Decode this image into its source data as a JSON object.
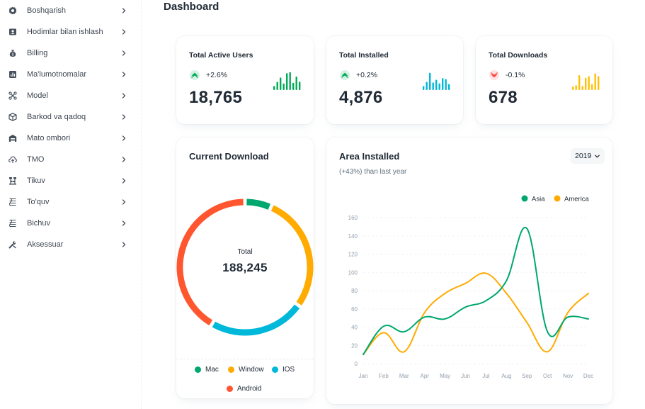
{
  "page": {
    "title": "Dashboard"
  },
  "sidebar": {
    "items": [
      {
        "label": "Boshqarish",
        "icon": "gear-icon"
      },
      {
        "label": "Hodimlar bilan ishlash",
        "icon": "id-card-icon"
      },
      {
        "label": "Billing",
        "icon": "money-bag-icon"
      },
      {
        "label": "Ma'lumotnomalar",
        "icon": "report-chart-icon"
      },
      {
        "label": "Model",
        "icon": "network-icon"
      },
      {
        "label": "Barkod va qadoq",
        "icon": "package-icon"
      },
      {
        "label": "Mato ombori",
        "icon": "warehouse-icon"
      },
      {
        "label": "TMO",
        "icon": "cloud-upload-icon"
      },
      {
        "label": "Tikuv",
        "icon": "sewing-icon"
      },
      {
        "label": "To'quv",
        "icon": "weaving-icon"
      },
      {
        "label": "Bichuv",
        "icon": "cutting-icon"
      },
      {
        "label": "Aksessuar",
        "icon": "tools-icon"
      }
    ]
  },
  "stats": [
    {
      "title": "Total Active Users",
      "trend": "+2.6%",
      "direction": "up",
      "value": "18,765",
      "color": "#00ab55",
      "bars": [
        20,
        41,
        63,
        33,
        85,
        90,
        36,
        68,
        42
      ]
    },
    {
      "title": "Total Installed",
      "trend": "+0.2%",
      "direction": "up",
      "value": "4,876",
      "color": "#00b8d9",
      "bars": [
        20,
        41,
        87,
        38,
        52,
        34,
        60,
        55,
        30
      ]
    },
    {
      "title": "Total Downloads",
      "trend": "-0.1%",
      "direction": "down",
      "value": "678",
      "color": "#ffc107",
      "bars": [
        18,
        24,
        75,
        20,
        62,
        70,
        30,
        84,
        70
      ]
    }
  ],
  "colors": {
    "up_icon": "#00ab55",
    "down_icon": "#ff4842"
  },
  "current_download": {
    "title": "Current Download",
    "total_label": "Total",
    "total_value": "188,245",
    "legend": [
      {
        "label": "Mac",
        "color": "#00a76f"
      },
      {
        "label": "Window",
        "color": "#ffab00"
      },
      {
        "label": "IOS",
        "color": "#00b8d9"
      },
      {
        "label": "Android",
        "color": "#ff5630"
      }
    ]
  },
  "area_installed": {
    "title": "Area Installed",
    "subtitle": "(+43%) than last year",
    "year": "2019"
  },
  "chart_data": [
    {
      "type": "pie",
      "variant": "donut",
      "title": "Current Download",
      "categories": [
        "Mac",
        "Window",
        "IOS",
        "Android"
      ],
      "values": [
        12244,
        53345,
        44313,
        78343
      ],
      "colors": [
        "#00a76f",
        "#ffab00",
        "#00b8d9",
        "#ff5630"
      ],
      "center_label": "Total",
      "center_value": "188,245"
    },
    {
      "type": "line",
      "title": "Area Installed",
      "categories": [
        "Jan",
        "Feb",
        "Mar",
        "Apr",
        "May",
        "Jun",
        "Jul",
        "Aug",
        "Sep",
        "Oct",
        "Nov",
        "Dec"
      ],
      "series": [
        {
          "name": "Asia",
          "color": "#00a76f",
          "values": [
            10,
            41,
            35,
            51,
            49,
            62,
            69,
            91,
            148,
            35,
            51,
            49
          ]
        },
        {
          "name": "America",
          "color": "#ffab00",
          "values": [
            10,
            34,
            13,
            56,
            77,
            88,
            99,
            77,
            45,
            13,
            56,
            77
          ]
        }
      ],
      "yticks": [
        0,
        20,
        40,
        60,
        80,
        100,
        120,
        140,
        160
      ],
      "ylim": [
        0,
        160
      ],
      "grid": true,
      "legend_position": "top-right",
      "smooth": true
    }
  ]
}
